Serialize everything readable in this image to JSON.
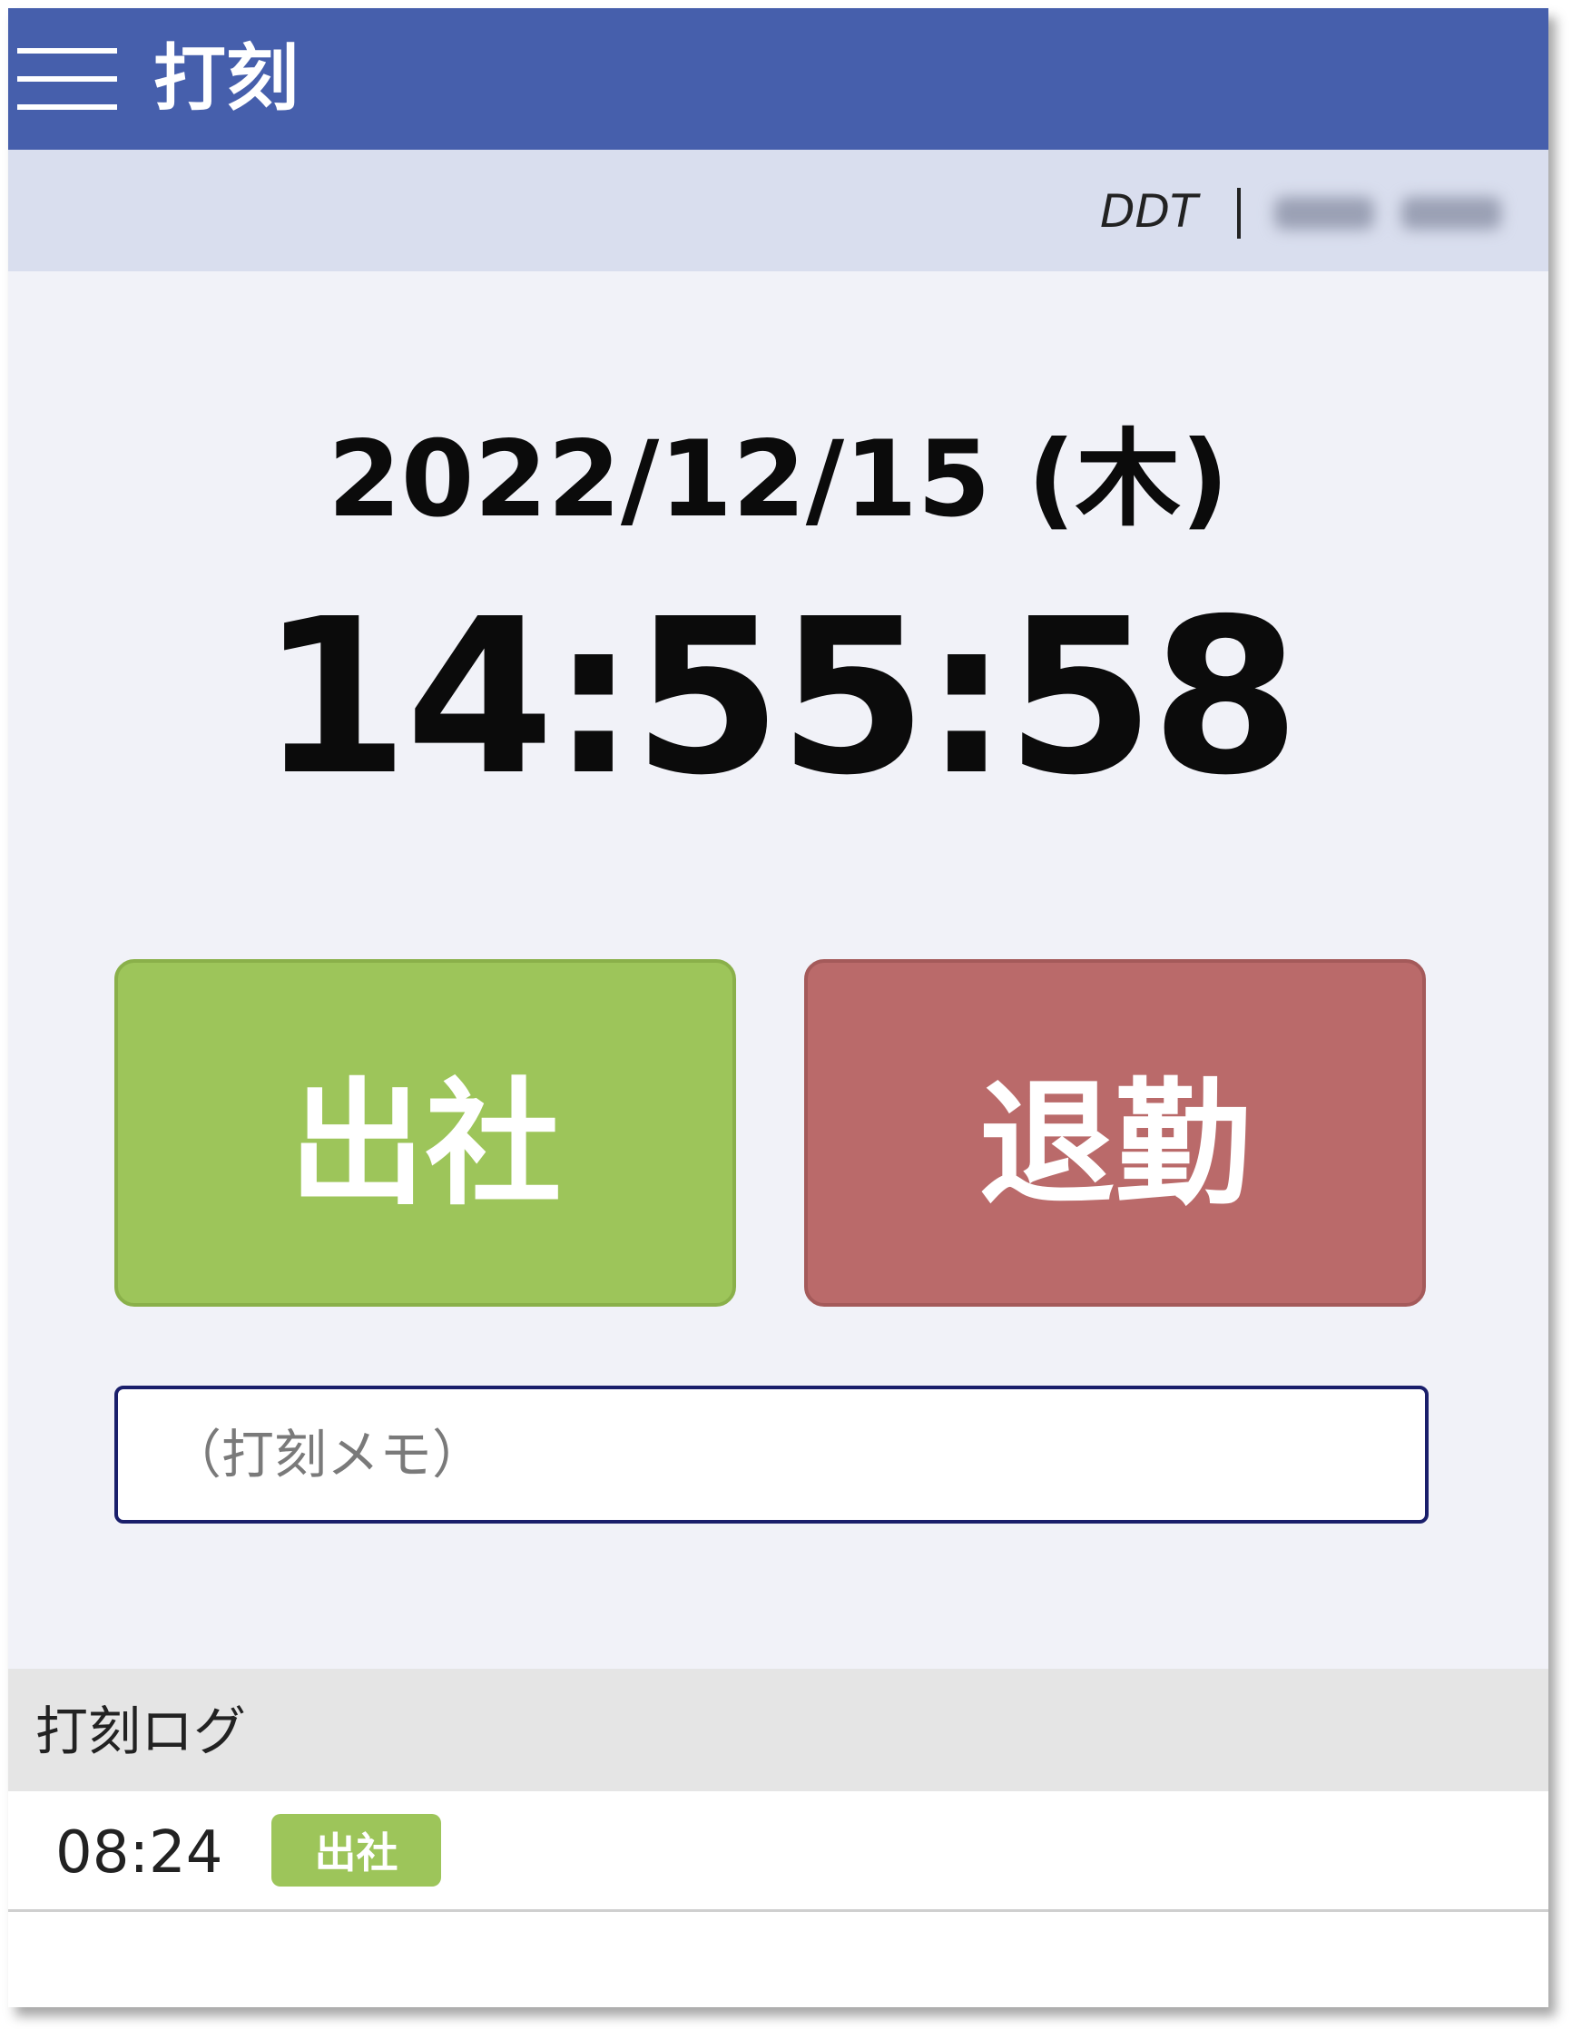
{
  "header": {
    "title": "打刻",
    "menu_icon": "hamburger-menu-icon"
  },
  "user_bar": {
    "organization": "DDT",
    "separator": "|"
  },
  "clock": {
    "date": "2022/12/15 (木)",
    "time": "14:55:58"
  },
  "actions": {
    "clock_in_label": "出社",
    "clock_out_label": "退勤",
    "clock_in_color": "#9dc55a",
    "clock_out_color": "#ba6a6a"
  },
  "memo": {
    "placeholder": "（打刻メモ）",
    "value": ""
  },
  "log": {
    "title": "打刻ログ",
    "entries": [
      {
        "time": "08:24",
        "type": "出社"
      }
    ]
  },
  "colors": {
    "accent": "#465fac",
    "subbar": "#d9deee",
    "background": "#f1f2f8"
  }
}
